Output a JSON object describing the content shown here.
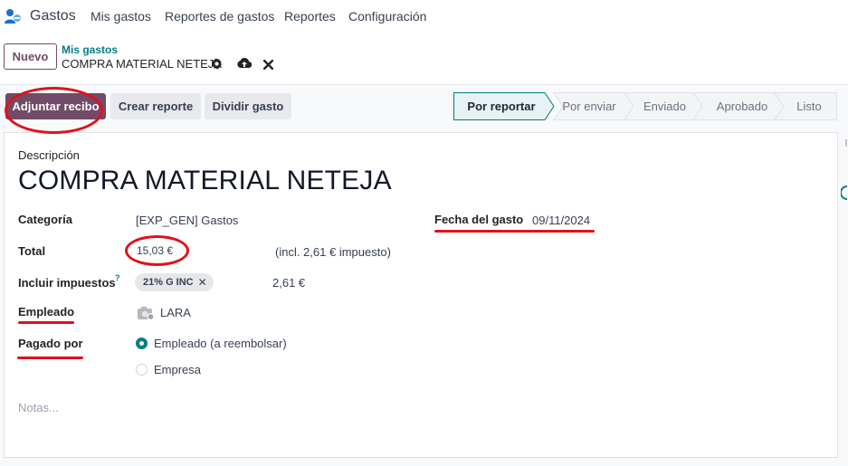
{
  "app": {
    "name": "Gastos"
  },
  "topnav": {
    "items": [
      "Mis gastos",
      "Reportes de gastos",
      "Reportes",
      "Configuración"
    ]
  },
  "control": {
    "new_label": "Nuevo",
    "breadcrumb_parent": "Mis gastos",
    "breadcrumb_current": "COMPRA MATERIAL NETEJA"
  },
  "actions": {
    "attach_receipt": "Adjuntar recibo",
    "create_report": "Crear reporte",
    "split_expense": "Dividir gasto"
  },
  "status": {
    "steps": [
      "Por reportar",
      "Por enviar",
      "Enviado",
      "Aprobado",
      "Listo"
    ],
    "active": "Por reportar"
  },
  "form": {
    "description_label": "Descripción",
    "description": "COMPRA MATERIAL NETEJA",
    "category_label": "Categoría",
    "category": "[EXP_GEN] Gastos",
    "total_label": "Total",
    "total": "15,03 €",
    "tax_included_note": "(incl. 2,61 € impuesto)",
    "date_label": "Fecha del gasto",
    "date": "09/11/2024",
    "taxes_label": "Incluir impuestos",
    "taxes_help": "?",
    "tax_tag": "21% G INC",
    "tax_amount": "2,61 €",
    "employee_label": "Empleado",
    "employee": "LARA",
    "paid_by_label": "Pagado por",
    "paid_by_options": [
      "Empleado (a reembolsar)",
      "Empresa"
    ],
    "paid_by_selected": "Empleado (a reembolsar)",
    "notes_placeholder": "Notas..."
  },
  "colors": {
    "brand": "#714b67",
    "accent": "#017e84",
    "annotation": "#e0111b"
  }
}
